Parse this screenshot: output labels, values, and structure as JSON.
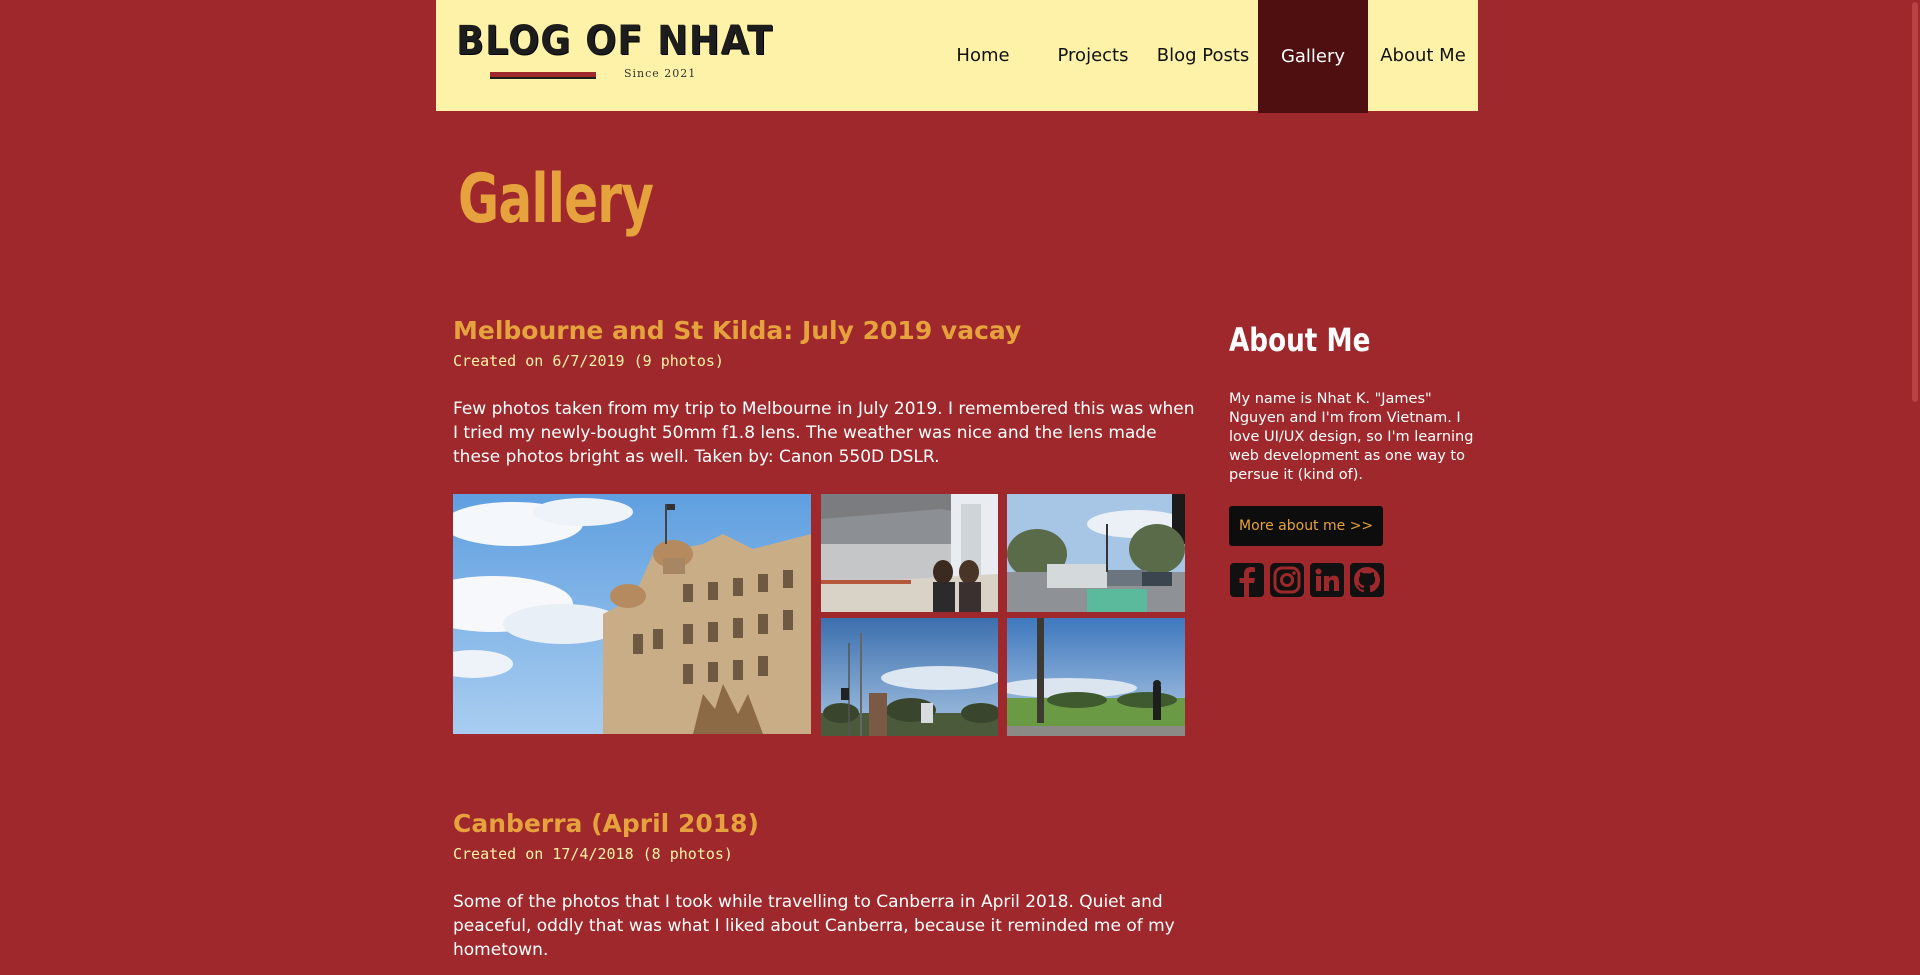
{
  "header": {
    "logo_title": "BLOG OF NHAT",
    "logo_since": "Since 2021",
    "nav": [
      {
        "label": "Home",
        "active": false
      },
      {
        "label": "Projects",
        "active": false
      },
      {
        "label": "Blog Posts",
        "active": false
      },
      {
        "label": "Gallery",
        "active": true
      },
      {
        "label": "About Me",
        "active": false
      }
    ]
  },
  "page_title": "Gallery",
  "albums": [
    {
      "title": "Melbourne and St Kilda: July 2019 vacay",
      "meta": "Created on 6/7/2019 (9 photos)",
      "description": "Few photos taken from my trip to Melbourne in July 2019. I remembered this was when I tried my newly-bought 50mm f1.8 lens. The weather was nice and the lens made these photos bright as well. Taken by: Canon 550D DSLR."
    },
    {
      "title": "Canberra (April 2018)",
      "meta": "Created on 17/4/2018 (8 photos)",
      "description": "Some of the photos that I took while travelling to Canberra in April 2018. Quiet and peaceful, oddly that was what I liked about Canberra, because it reminded me of my hometown."
    }
  ],
  "sidebar": {
    "title": "About Me",
    "text": "My name is Nhat K. \"James\" Nguyen and I'm from Vietnam. I love UI/UX design, so I'm learning web development as one way to persue it (kind of).",
    "button": "More about me >>",
    "socials": [
      "facebook-icon",
      "instagram-icon",
      "linkedin-icon",
      "github-icon"
    ]
  },
  "colors": {
    "background": "#9e282b",
    "header_bg": "#fdf2a7",
    "nav_active": "#4f0f10",
    "accent": "#e6a23c"
  }
}
